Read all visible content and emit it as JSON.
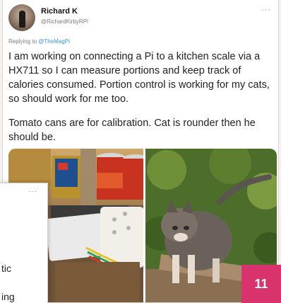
{
  "tweet": {
    "author_name": "Richard K",
    "author_handle": "@RichardKirbyRPi",
    "more_menu": "···",
    "replying_prefix": "Replying to",
    "replying_to": "@TheMagPi",
    "text_paragraphs": [
      "I am working on connecting a Pi to a kitchen scale via a HX711 so I can measure portions and keep track of calories consumed. Portion control is working for my cats, so should work for me too.",
      "Tomato cans are for calibration. Cat is rounder then he should be."
    ],
    "images": [
      {
        "description_icon": "kitchen-scale-photo"
      },
      {
        "description_icon": "cat-photo"
      }
    ]
  },
  "overlay_card": {
    "more_menu": "···",
    "text_fragment_1": "tic",
    "text_fragment_2": "ing"
  },
  "page_badge": {
    "number": "11",
    "color": "#d8336c"
  },
  "colors": {
    "link": "#3b94d9",
    "text": "#222222",
    "secondary": "#7a7a7a"
  }
}
